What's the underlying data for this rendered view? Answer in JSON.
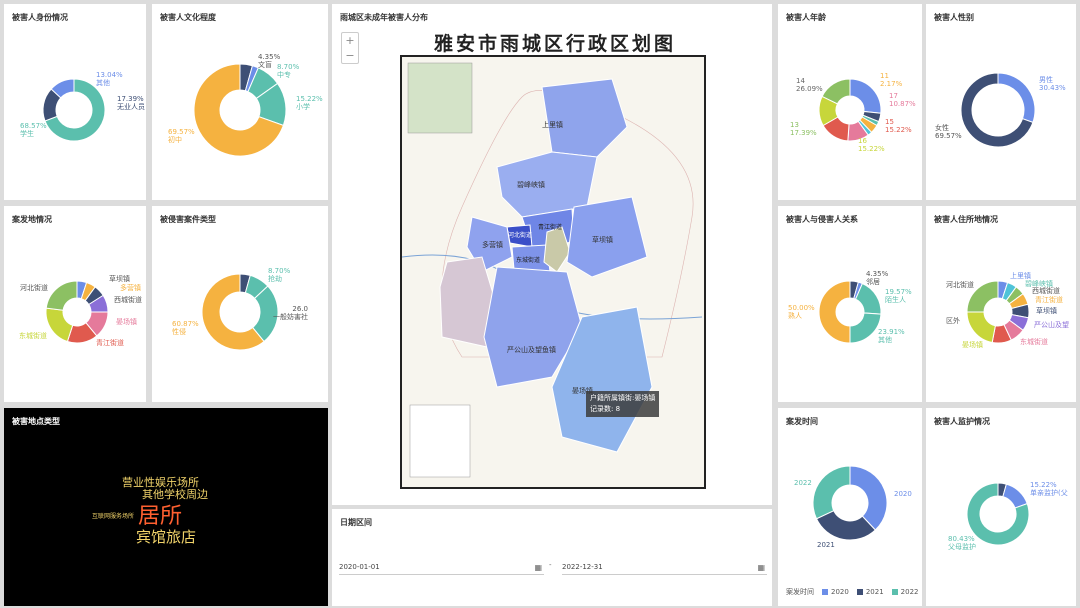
{
  "panels": {
    "identity": "被害人身份情况",
    "education": "被害人文化程度",
    "map": "雨城区未成年被害人分布",
    "age": "被害人年龄",
    "gender": "被害人性别",
    "location": "案发地情况",
    "case_type": "被侵害案件类型",
    "relation": "被害人与侵害人关系",
    "residence": "被害人住所地情况",
    "place_type": "被害地点类型",
    "date_range": "日期区间",
    "case_time": "案发时间",
    "guardian": "被害人监护情况"
  },
  "identity": {
    "slices": [
      {
        "name": "学生",
        "value": 68.57,
        "color": "#5bbfad"
      },
      {
        "name": "无业人员",
        "value": 17.39,
        "color": "#3e4f75"
      },
      {
        "name": "其他",
        "value": 13.04,
        "color": "#6c8ee8"
      }
    ],
    "labels": {
      "student": "68.57%\n学生",
      "unemployed": "17.39%\n无业人员",
      "other": "13.04%\n其他"
    }
  },
  "education": {
    "labels": {
      "wenmang": "4.35%\n文盲",
      "zhongzhuan": "8.70%\n中专",
      "xiaoxue": "15.22%\n小学",
      "chuzhong": "69.57%\n初中"
    }
  },
  "age": {
    "labels": {
      "a14": "14\n26.09%",
      "a13": "13\n17.39%",
      "a11": "11\n2.17%",
      "a17": "17\n10.87%",
      "a15": "15\n15.22%",
      "a16": "16\n15.22%"
    }
  },
  "gender": {
    "labels": {
      "male": "男性\n30.43%",
      "female": "女性\n69.57%"
    }
  },
  "location": {
    "labels": {
      "caobazhen": "草坝镇",
      "duoying": "多营镇",
      "xicheng": "西城街道",
      "yanchang": "晏场镇",
      "qingjiang": "青江街道",
      "dongcheng": "东城街道",
      "hebei": "河北街道"
    }
  },
  "case_type": {
    "labels": {
      "rob": "8.70%\n抢劫",
      "social": "26.0\n一般妨害社",
      "rape": "60.87%\n性侵"
    }
  },
  "relation": {
    "labels": {
      "relative": "4.35%\n邻居",
      "stranger": "19.57%\n陌生人",
      "other": "23.91%\n其他",
      "acquaintance": "50.00%\n熟人"
    }
  },
  "residence": {
    "labels": {
      "shangli": "上里镇",
      "bifengxia": "碧峰峡镇",
      "xicheng": "西城街道",
      "qingjiang": "青江街道",
      "caoba": "草坝镇",
      "yangong": "严公山及望",
      "dongcheng": "东城街道",
      "yanchang": "晏场镇",
      "hebei": "河北街道",
      "outside": "区外"
    }
  },
  "wordcloud": [
    "营业性娱乐场所",
    "其他学校周边",
    "互联网服务场所",
    "居所",
    "宾馆旅店"
  ],
  "map": {
    "title": "雅安市雨城区行政区划图",
    "districts": [
      "上里镇",
      "碧峰峡镇",
      "青江街道",
      "河北街道",
      "多营镇",
      "东城街道",
      "草坝镇",
      "严公山及望鱼镇",
      "晏场镇"
    ],
    "tooltip_line1": "户籍所属镇街:晏场镇",
    "tooltip_line2": "记录数: 8",
    "zoom_in": "+",
    "zoom_out": "−"
  },
  "date_range": {
    "start": "2020-01-01",
    "separator": "-",
    "end": "2022-12-31"
  },
  "case_time": {
    "labels": {
      "y2020": "2020",
      "y2021": "2021",
      "y2022": "2022"
    },
    "legend_title": "案发时间",
    "legend": [
      "2020",
      "2021",
      "2022"
    ],
    "colors": [
      "#6c8ee8",
      "#3e4f75",
      "#5bbfad"
    ]
  },
  "guardian": {
    "labels": {
      "single": "15.22%\n单亲监护(父",
      "parents": "80.43%\n父母监护"
    }
  }
}
